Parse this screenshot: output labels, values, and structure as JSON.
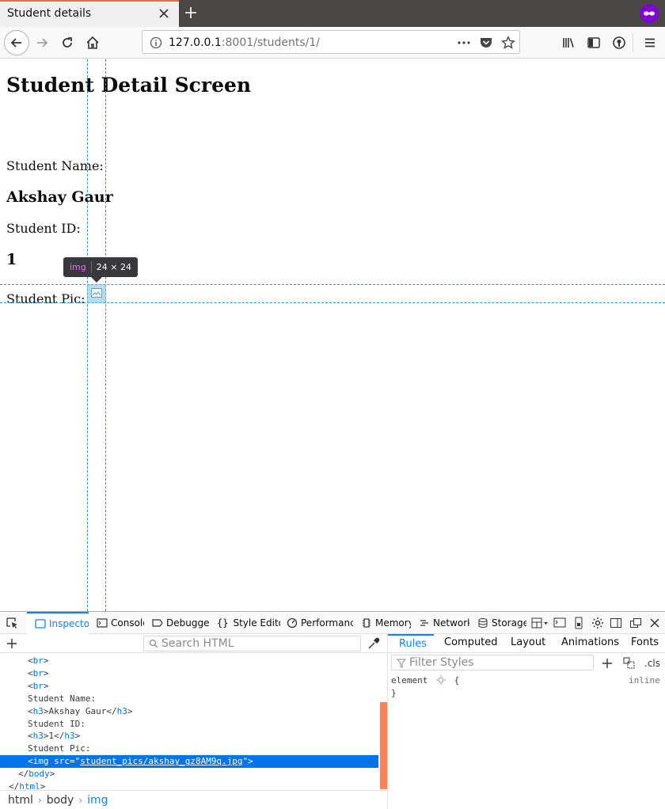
{
  "browser": {
    "tab_title": "Student details",
    "url_host": "127.0.0.1",
    "url_rest": ":8001/students/1/"
  },
  "page": {
    "heading": "Student Detail Screen",
    "name_label": "Student Name:",
    "name_value": "Akshay Gaur",
    "id_label": "Student ID:",
    "id_value": "1",
    "pic_label": "Student Pic:"
  },
  "inspector_tooltip": {
    "tag": "img",
    "size": "24 × 24"
  },
  "devtools": {
    "tabs": [
      "Inspector",
      "Console",
      "Debugger",
      "Style Editor",
      "Performance",
      "Memory",
      "Network",
      "Storage"
    ],
    "search_placeholder": "Search HTML",
    "tree": [
      {
        "indent": 3,
        "text": "<br>"
      },
      {
        "indent": 3,
        "text": "<br>"
      },
      {
        "indent": 3,
        "text": "<br>"
      },
      {
        "indent": 3,
        "text": "Student Name:"
      },
      {
        "indent": 3,
        "text": "<h3>Akshay Gaur</h3>"
      },
      {
        "indent": 3,
        "text": "Student ID:"
      },
      {
        "indent": 3,
        "text": "<h3>1</h3>"
      },
      {
        "indent": 3,
        "text": "Student Pic:"
      },
      {
        "indent": 3,
        "text": "<img src=\"student_pics/akshay_gz8AM9q.jpg\">",
        "selected": true
      },
      {
        "indent": 2,
        "text": "</body>"
      },
      {
        "indent": 1,
        "text": "</html>"
      }
    ],
    "breadcrumbs": [
      "html",
      "body",
      "img"
    ],
    "side_tabs": [
      "Rules",
      "Computed",
      "Layout",
      "Animations",
      "Fonts"
    ],
    "filter_placeholder": "Filter Styles",
    "cls_label": ".cls",
    "rule_selector": "element",
    "rule_open": "{",
    "rule_close": "}",
    "rule_source": "inline"
  },
  "colors": {
    "accent": "#0a84ff",
    "selection": "#0074e8",
    "tab_accent": "#e76f48",
    "private_mask": "#8000d7"
  }
}
